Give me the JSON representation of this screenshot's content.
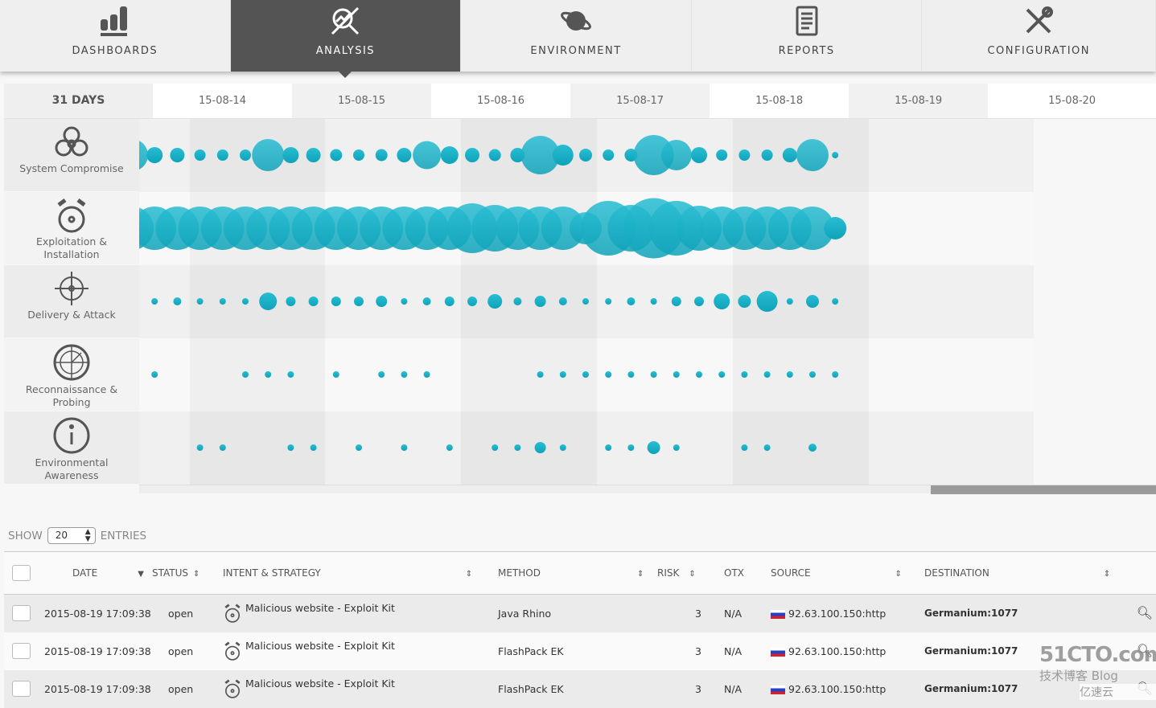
{
  "nav": {
    "tabs": [
      {
        "label": "DASHBOARDS",
        "icon": "bar-chart-icon"
      },
      {
        "label": "ANALYSIS",
        "icon": "analysis-magnifier-icon",
        "active": true
      },
      {
        "label": "ENVIRONMENT",
        "icon": "planet-icon"
      },
      {
        "label": "REPORTS",
        "icon": "report-document-icon"
      },
      {
        "label": "CONFIGURATION",
        "icon": "tools-icon"
      }
    ]
  },
  "timeline": {
    "range_label": "31 DAYS",
    "dates": [
      "15-08-14",
      "15-08-15",
      "15-08-16",
      "15-08-17",
      "15-08-18",
      "15-08-19",
      "15-08-20"
    ]
  },
  "chart_data": {
    "type": "bubble",
    "color": "#1fb0c7",
    "rows": [
      {
        "label": "System Compromise",
        "icon": "biohazard-icon",
        "values": [
          40,
          20,
          18,
          14,
          14,
          14,
          40,
          20,
          18,
          15,
          14,
          15,
          18,
          35,
          22,
          18,
          15,
          18,
          48,
          26,
          16,
          14,
          16,
          50,
          38,
          20,
          14,
          14,
          14,
          18,
          40,
          8
        ]
      },
      {
        "label": "Exploitation & Installation",
        "icon": "alarm-bomb-icon",
        "values": [
          54,
          54,
          54,
          54,
          54,
          54,
          54,
          54,
          54,
          54,
          54,
          54,
          54,
          54,
          54,
          62,
          58,
          54,
          54,
          54,
          40,
          68,
          58,
          75,
          68,
          56,
          54,
          54,
          54,
          54,
          54,
          28
        ]
      },
      {
        "label": "Delivery & Attack",
        "icon": "crosshair-icon",
        "values": [
          null,
          8,
          10,
          8,
          8,
          8,
          22,
          12,
          12,
          12,
          12,
          14,
          8,
          10,
          12,
          12,
          18,
          10,
          14,
          10,
          8,
          8,
          10,
          8,
          12,
          12,
          20,
          16,
          26,
          8,
          16,
          8
        ]
      },
      {
        "label": "Reconnaissance & Probing",
        "icon": "radar-icon",
        "values": [
          null,
          8,
          null,
          null,
          null,
          8,
          8,
          8,
          null,
          8,
          null,
          8,
          8,
          8,
          null,
          null,
          null,
          null,
          8,
          8,
          8,
          8,
          8,
          8,
          8,
          8,
          8,
          8,
          8,
          8,
          8,
          8
        ]
      },
      {
        "label": "Environmental Awareness",
        "icon": "info-icon",
        "values": [
          null,
          null,
          null,
          8,
          8,
          null,
          null,
          8,
          8,
          null,
          8,
          null,
          8,
          null,
          8,
          null,
          8,
          8,
          14,
          8,
          null,
          8,
          8,
          16,
          8,
          null,
          null,
          8,
          8,
          null,
          10,
          null
        ]
      }
    ]
  },
  "table": {
    "show_label": "SHOW",
    "entries_label": "ENTRIES",
    "page_size": "20",
    "columns": [
      "DATE",
      "STATUS",
      "INTENT & STRATEGY",
      "METHOD",
      "RISK",
      "OTX",
      "SOURCE",
      "DESTINATION"
    ],
    "rows": [
      {
        "date": "2015-08-19 17:09:38",
        "status": "open",
        "intent": "Malicious website - Exploit Kit",
        "method": "Java Rhino",
        "risk": "3",
        "otx": "N/A",
        "source": "92.63.100.150:http",
        "destination": "Germanium:1077"
      },
      {
        "date": "2015-08-19 17:09:38",
        "status": "open",
        "intent": "Malicious website - Exploit Kit",
        "method": "FlashPack EK",
        "risk": "3",
        "otx": "N/A",
        "source": "92.63.100.150:http",
        "destination": "Germanium:1077"
      },
      {
        "date": "2015-08-19 17:09:38",
        "status": "open",
        "intent": "Malicious website - Exploit Kit",
        "method": "FlashPack EK",
        "risk": "3",
        "otx": "N/A",
        "source": "92.63.100.150:http",
        "destination": "Germanium:1077"
      }
    ]
  },
  "watermark": {
    "line1": "51CTO.com",
    "line2": "技术博客 Blog",
    "line3": "亿速云"
  }
}
